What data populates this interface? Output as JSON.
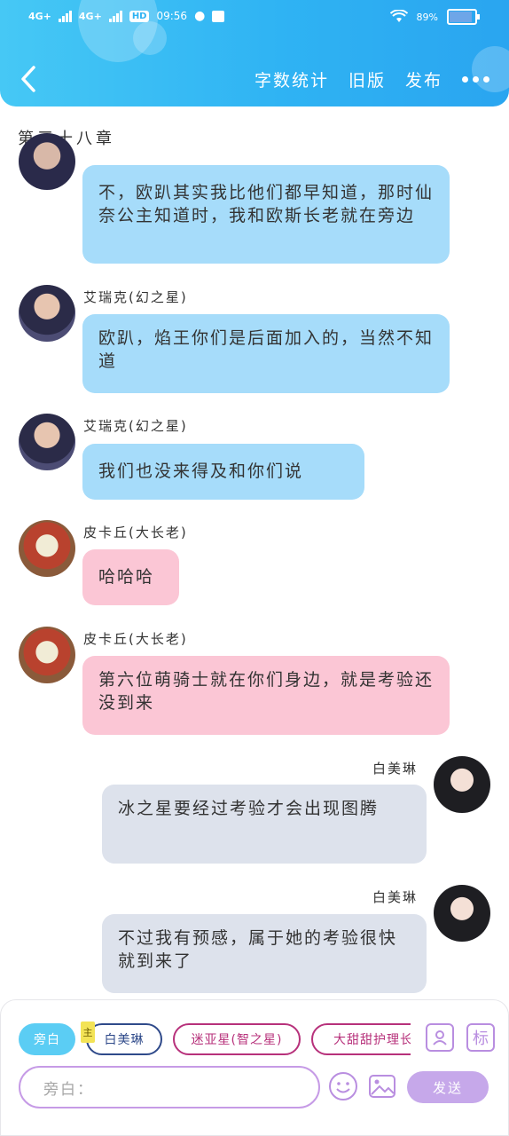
{
  "status_bar": {
    "network1": "4G+",
    "network2": "4G+",
    "hd": "HD",
    "time": "09:56",
    "battery": "89%",
    "battery_level": 0.89
  },
  "nav": {
    "word_count": "字数统计",
    "old_version": "旧版",
    "publish": "发布"
  },
  "chapter_title": "第三十八章",
  "messages": [
    {
      "speaker": "",
      "text": "不，欧趴其实我比他们都早知道，那时仙奈公主知道时，我和欧斯长老就在旁边",
      "style": "blue",
      "side": "left"
    },
    {
      "speaker": "艾瑞克(幻之星)",
      "text": "欧趴，焰王你们是后面加入的，当然不知道",
      "style": "blue",
      "side": "left"
    },
    {
      "speaker": "艾瑞克(幻之星)",
      "text": "我们也没来得及和你们说",
      "style": "blue",
      "side": "left"
    },
    {
      "speaker": "皮卡丘(大长老)",
      "text": "哈哈哈",
      "style": "pink",
      "side": "left"
    },
    {
      "speaker": "皮卡丘(大长老)",
      "text": "第六位萌骑士就在你们身边，就是考验还没到来",
      "style": "pink",
      "side": "left"
    },
    {
      "speaker": "白美琳",
      "text": "冰之星要经过考验才会出现图腾",
      "style": "gray",
      "side": "right"
    },
    {
      "speaker": "白美琳",
      "text": "不过我有预感，属于她的考验很快就到来了",
      "style": "gray",
      "side": "right"
    }
  ],
  "composer": {
    "chips": [
      "旁白",
      "白美琳",
      "迷亚星(智之星)",
      "大甜甜护理长"
    ],
    "main_tag": "主",
    "label_btn": "标",
    "input_placeholder": "旁白：",
    "send": "发送"
  }
}
